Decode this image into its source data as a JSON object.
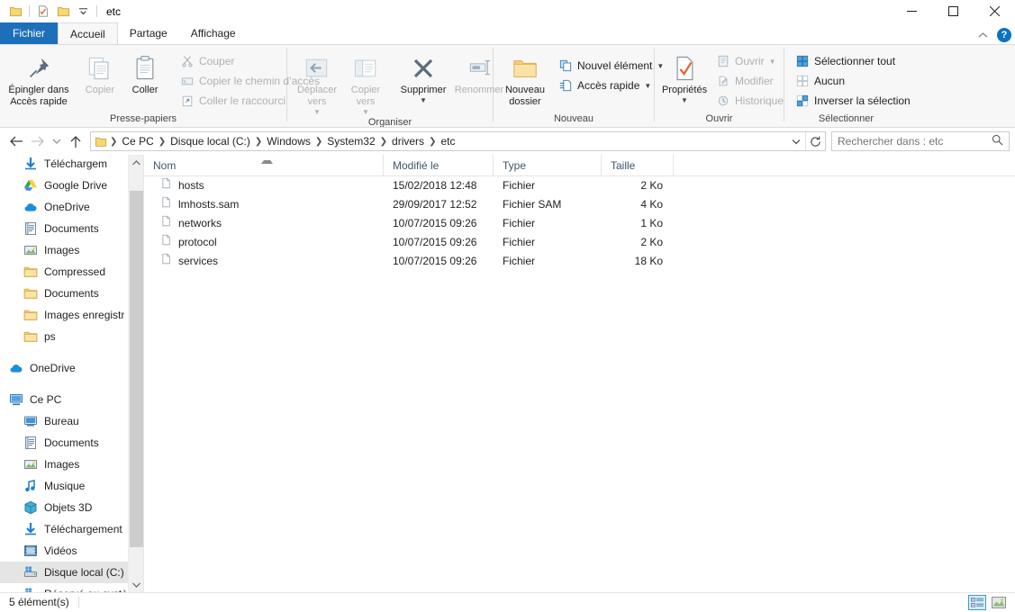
{
  "window": {
    "title": "etc",
    "quick_access": [
      "folder-icon",
      "properties-icon",
      "new-folder-icon",
      "customize-qat-caret"
    ],
    "controls": {
      "minimize": "minimize-icon",
      "maximize": "maximize-icon",
      "close": "close-icon"
    }
  },
  "tabs": [
    {
      "label": "Fichier",
      "kind": "file"
    },
    {
      "label": "Accueil",
      "kind": "active"
    },
    {
      "label": "Partage",
      "kind": "normal"
    },
    {
      "label": "Affichage",
      "kind": "normal"
    }
  ],
  "tab_right": {
    "collapse": "chevron-up-icon",
    "help": "?"
  },
  "ribbon": {
    "groups": [
      {
        "name": "Presse-papiers",
        "label": "Presse-papiers",
        "big": [
          {
            "label": "Épingler dans\nAccès rapide",
            "icon": "pin-icon",
            "disabled": false
          },
          {
            "label": "Copier",
            "icon": "copy-icon",
            "disabled": true
          },
          {
            "label": "Coller",
            "icon": "paste-icon",
            "disabled": false
          }
        ],
        "small": [
          {
            "label": "Couper",
            "icon": "scissors-icon",
            "disabled": true
          },
          {
            "label": "Copier le chemin d’accès",
            "icon": "copy-path-icon",
            "disabled": true
          },
          {
            "label": "Coller le raccourci",
            "icon": "paste-shortcut-icon",
            "disabled": true
          }
        ]
      },
      {
        "name": "Organiser",
        "label": "Organiser",
        "big": [
          {
            "label": "Déplacer\nvers",
            "icon": "move-to-icon",
            "disabled": true,
            "caret": true
          },
          {
            "label": "Copier\nvers",
            "icon": "copy-to-icon",
            "disabled": true,
            "caret": true
          },
          {
            "label": "Supprimer",
            "icon": "delete-icon",
            "disabled": false,
            "caret": true
          },
          {
            "label": "Renommer",
            "icon": "rename-icon",
            "disabled": true
          }
        ],
        "small": []
      },
      {
        "name": "Nouveau",
        "label": "Nouveau",
        "big": [
          {
            "label": "Nouveau\ndossier",
            "icon": "new-folder-icon",
            "disabled": false
          }
        ],
        "small": [
          {
            "label": "Nouvel élément",
            "icon": "new-item-icon",
            "disabled": false,
            "caret": true
          },
          {
            "label": "Accès rapide",
            "icon": "easy-access-icon",
            "disabled": false,
            "caret": true
          }
        ]
      },
      {
        "name": "Ouvrir",
        "label": "Ouvrir",
        "big": [
          {
            "label": "Propriétés",
            "icon": "properties-icon",
            "disabled": false,
            "caret": true
          }
        ],
        "small": [
          {
            "label": "Ouvrir",
            "icon": "open-icon",
            "disabled": true,
            "caret": true
          },
          {
            "label": "Modifier",
            "icon": "edit-icon",
            "disabled": true
          },
          {
            "label": "Historique",
            "icon": "history-icon",
            "disabled": true
          }
        ]
      },
      {
        "name": "Sélectionner",
        "label": "Sélectionner",
        "big": [],
        "small": [
          {
            "label": "Sélectionner tout",
            "icon": "select-all-icon",
            "disabled": false
          },
          {
            "label": "Aucun",
            "icon": "select-none-icon",
            "disabled": false
          },
          {
            "label": "Inverser la sélection",
            "icon": "invert-selection-icon",
            "disabled": false
          }
        ]
      }
    ]
  },
  "navigation": {
    "back": "back-arrow-icon",
    "forward": "forward-arrow-icon",
    "recent": "recent-locations-icon",
    "up": "up-arrow-icon",
    "breadcrumbs": [
      "Ce PC",
      "Disque local (C:)",
      "Windows",
      "System32",
      "drivers",
      "etc"
    ],
    "dropdown": "chevron-down-icon",
    "refresh": "refresh-icon",
    "search_placeholder": "Rechercher dans : etc",
    "search_value": ""
  },
  "sidebar": {
    "items": [
      {
        "label": "Téléchargem",
        "icon": "download-icon",
        "indent": 1,
        "pinned": true,
        "selected": false
      },
      {
        "label": "Google Drive",
        "icon": "google-drive-icon",
        "indent": 1,
        "pinned": true,
        "selected": false
      },
      {
        "label": "OneDrive",
        "icon": "onedrive-icon",
        "indent": 1,
        "pinned": true,
        "selected": false
      },
      {
        "label": "Documents",
        "icon": "documents-icon",
        "indent": 1,
        "pinned": true,
        "selected": false
      },
      {
        "label": "Images",
        "icon": "pictures-icon",
        "indent": 1,
        "pinned": true,
        "selected": false
      },
      {
        "label": "Compressed",
        "icon": "folder-icon",
        "indent": 1,
        "pinned": false,
        "selected": false
      },
      {
        "label": "Documents",
        "icon": "folder-icon",
        "indent": 1,
        "pinned": false,
        "selected": false
      },
      {
        "label": "Images enregistr",
        "icon": "folder-icon",
        "indent": 1,
        "pinned": false,
        "selected": false
      },
      {
        "label": "ps",
        "icon": "folder-icon",
        "indent": 1,
        "pinned": false,
        "selected": false
      },
      {
        "label": "",
        "icon": "spacer",
        "indent": 0,
        "pinned": false,
        "selected": false
      },
      {
        "label": "OneDrive",
        "icon": "onedrive-icon",
        "indent": 0,
        "pinned": false,
        "selected": false
      },
      {
        "label": "",
        "icon": "spacer",
        "indent": 0,
        "pinned": false,
        "selected": false
      },
      {
        "label": "Ce PC",
        "icon": "this-pc-icon",
        "indent": 0,
        "pinned": false,
        "selected": false
      },
      {
        "label": "Bureau",
        "icon": "desktop-icon",
        "indent": 1,
        "pinned": false,
        "selected": false
      },
      {
        "label": "Documents",
        "icon": "documents-icon",
        "indent": 1,
        "pinned": false,
        "selected": false
      },
      {
        "label": "Images",
        "icon": "pictures-icon",
        "indent": 1,
        "pinned": false,
        "selected": false
      },
      {
        "label": "Musique",
        "icon": "music-icon",
        "indent": 1,
        "pinned": false,
        "selected": false
      },
      {
        "label": "Objets 3D",
        "icon": "objects-3d-icon",
        "indent": 1,
        "pinned": false,
        "selected": false
      },
      {
        "label": "Téléchargement",
        "icon": "download-icon",
        "indent": 1,
        "pinned": false,
        "selected": false
      },
      {
        "label": "Vidéos",
        "icon": "videos-icon",
        "indent": 1,
        "pinned": false,
        "selected": false
      },
      {
        "label": "Disque local (C:)",
        "icon": "drive-icon",
        "indent": 1,
        "pinned": false,
        "selected": true
      },
      {
        "label": "Réservé au systè",
        "icon": "drive-icon",
        "indent": 1,
        "pinned": false,
        "selected": false
      }
    ]
  },
  "filelist": {
    "columns": [
      {
        "label": "Nom",
        "sorted": true
      },
      {
        "label": "Modifié le",
        "sorted": false
      },
      {
        "label": "Type",
        "sorted": false
      },
      {
        "label": "Taille",
        "sorted": false
      }
    ],
    "rows": [
      {
        "name": "hosts",
        "modified": "15/02/2018 12:48",
        "type": "Fichier",
        "size": "2 Ko",
        "icon": "file-icon"
      },
      {
        "name": "lmhosts.sam",
        "modified": "29/09/2017 12:52",
        "type": "Fichier SAM",
        "size": "4 Ko",
        "icon": "file-icon"
      },
      {
        "name": "networks",
        "modified": "10/07/2015 09:26",
        "type": "Fichier",
        "size": "1 Ko",
        "icon": "file-icon"
      },
      {
        "name": "protocol",
        "modified": "10/07/2015 09:26",
        "type": "Fichier",
        "size": "2 Ko",
        "icon": "file-icon"
      },
      {
        "name": "services",
        "modified": "10/07/2015 09:26",
        "type": "Fichier",
        "size": "18 Ko",
        "icon": "file-icon"
      }
    ]
  },
  "statusbar": {
    "count": "5 élément(s)",
    "views": [
      {
        "name": "details-view",
        "active": true
      },
      {
        "name": "large-icons-view",
        "active": false
      }
    ]
  },
  "colors": {
    "accent": "#1e6fba",
    "ribbon_bg": "#f7f7f7",
    "selection": "#e5e5e5",
    "header_text": "#40556b",
    "folder_yellow": "#f8d775",
    "help_blue": "#0b72c4"
  }
}
